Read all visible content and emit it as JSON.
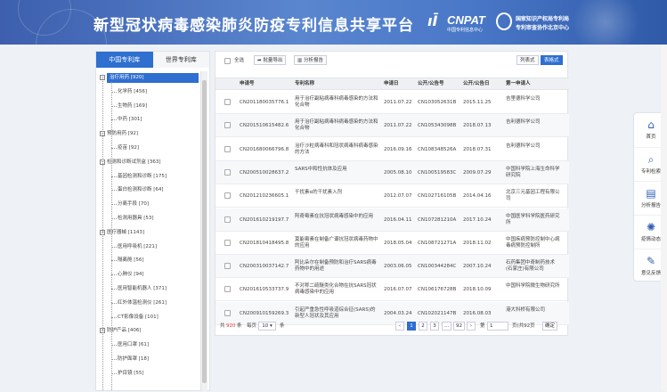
{
  "header": {
    "title": "新型冠状病毒感染肺炎防疫专利信息共享平台",
    "logo_text": "CNPAT",
    "logo_sub": "中国专利信息中心",
    "org_line1": "国家知识产权局专利局",
    "org_line2": "专利审查协作北京中心"
  },
  "tabs": [
    {
      "label": "中国专利库",
      "active": true
    },
    {
      "label": "世界专利库",
      "active": false
    }
  ],
  "tree": [
    {
      "label": "治疗用药 [920]",
      "level": 0,
      "selected": true
    },
    {
      "label": "化学药 [456]",
      "level": 1
    },
    {
      "label": "生物药 [169]",
      "level": 1
    },
    {
      "label": "中药 [301]",
      "level": 1
    },
    {
      "label": "预防用药 [92]",
      "level": 0
    },
    {
      "label": "疫苗 [92]",
      "level": 1
    },
    {
      "label": "检测和诊断试剂盒 [363]",
      "level": 0
    },
    {
      "label": "基因检测和诊断 [175]",
      "level": 1
    },
    {
      "label": "蛋白检测和诊断 [64]",
      "level": 1
    },
    {
      "label": "分离手段 [70]",
      "level": 1
    },
    {
      "label": "检测用器具 [53]",
      "level": 1
    },
    {
      "label": "医疗器械 [1143]",
      "level": 0
    },
    {
      "label": "医用呼吸机 [221]",
      "level": 1
    },
    {
      "label": "隔离舱 [56]",
      "level": 1
    },
    {
      "label": "心肺仪 [94]",
      "level": 1
    },
    {
      "label": "医用智能机器人 [371]",
      "level": 1
    },
    {
      "label": "红外体温检测仪 [261]",
      "level": 1
    },
    {
      "label": "CT影像设备 [101]",
      "level": 1
    },
    {
      "label": "防护产品 [406]",
      "level": 0
    },
    {
      "label": "医用口罩 [61]",
      "level": 1
    },
    {
      "label": "防护面罩 [18]",
      "level": 1
    },
    {
      "label": "护目镜 [55]",
      "level": 1
    }
  ],
  "toolbar": {
    "select_all": "全选",
    "export": "批量导出",
    "analysis": "分析报告",
    "list_view": "列表式",
    "table_view": "表格式"
  },
  "table": {
    "headers": [
      "申请号",
      "专利名称",
      "申请日",
      "公开/公告号",
      "公开/公告日",
      "第一申请人"
    ],
    "rows": [
      [
        "CN201180035776.1",
        "用于治疗副粘病毒科病毒感染的方法和化合物",
        "2011.07.22",
        "CN103052631B",
        "2015.11.25",
        "吉里德科学公司"
      ],
      [
        "CN201510615482.6",
        "用于治疗副粘病毒科病毒感染的方法和化合物",
        "2011.07.22",
        "CN105343098B",
        "2018.07.13",
        "吉利德科学公司"
      ],
      [
        "CN201680066796.8",
        "治疗沙粒病毒科和冠状病毒科病毒感染的方法",
        "2016.09.16",
        "CN108348526A",
        "2018.07.31",
        "吉利德科学公司"
      ],
      [
        "CN200510028637.2",
        "SARS中和性抗体及应用",
        "2005.08.10",
        "CN100519583C",
        "2009.07.29",
        "中国科学院上海生命科学研究院"
      ],
      [
        "CN201210236605.1",
        "干扰素α的干扰素入剂",
        "2012.07.07",
        "CN102716105B",
        "2014.04.16",
        "北京三元基因工程有限公司"
      ],
      [
        "CN201610219197.7",
        "阿奇霉素在抗冠状病毒感染中的应用",
        "2016.04.11",
        "CN107281210A",
        "2017.10.24",
        "中国医学科学院医药研究所"
      ],
      [
        "CN201810418495.8",
        "莫能霉素在制备广谱抗冠状病毒药物中的应用",
        "2018.05.04",
        "CN108721271A",
        "2018.11.02",
        "中国疾病预防控制中心病毒病预防控制所"
      ],
      [
        "CN200310037142.7",
        "阿比朵尔在制备预防和治疗SARS病毒药物中的用途",
        "2003.06.05",
        "CN100344284C",
        "2007.10.24",
        "石药集团中奇制药技术(石家庄)有限公司"
      ],
      [
        "CN201610533737.9",
        "不对称二硫醚类化合物在抗SARS冠状病毒感染中的应用",
        "2016.07.07",
        "CN106176728B",
        "2018.10.09",
        "中国科学院微生物研究所"
      ],
      [
        "CN200910159269.3",
        "引起严重急性呼吸道综合征(SARS)的新型人冠状及其应用",
        "2004.03.24",
        "CN102021147B",
        "2016.08.03",
        "港大科桥有限公司"
      ]
    ]
  },
  "pager": {
    "total_prefix": "共",
    "total": "920",
    "total_suffix": "条",
    "per_page_label": "每页",
    "per_page": "10",
    "per_page_unit": "条",
    "pages": [
      "1",
      "2",
      "3",
      "...",
      "92"
    ],
    "next": "›",
    "goto_prefix": "第",
    "goto_value": "1",
    "goto_suffix": "页(共92页",
    "confirm": "确定"
  },
  "side_nav": [
    {
      "label": "首页",
      "icon": "home-icon"
    },
    {
      "label": "专利检索",
      "icon": "search-icon"
    },
    {
      "label": "分析报告",
      "icon": "report-icon"
    },
    {
      "label": "疫情动态",
      "icon": "virus-icon"
    },
    {
      "label": "意见反馈",
      "icon": "feedback-icon"
    }
  ]
}
